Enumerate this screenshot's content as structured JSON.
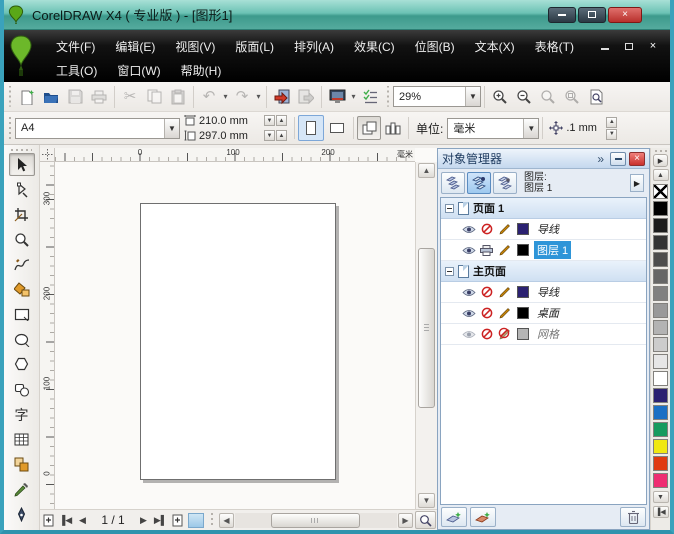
{
  "window": {
    "title": "CorelDRAW X4 ( 专业版 ) - [图形1]"
  },
  "menu": {
    "row1": [
      "文件(F)",
      "编辑(E)",
      "视图(V)",
      "版面(L)",
      "排列(A)",
      "效果(C)",
      "位图(B)",
      "文本(X)",
      "表格(T)"
    ],
    "row2": [
      "工具(O)",
      "窗口(W)",
      "帮助(H)"
    ]
  },
  "toolbar": {
    "zoom_level": "29%"
  },
  "property_bar": {
    "paper_preset": "A4",
    "paper_width": "210.0 mm",
    "paper_height": "297.0 mm",
    "units_label": "单位:",
    "units_value": "毫米",
    "nudge_offset": ".1 mm"
  },
  "rulers": {
    "top_labels": [
      "0",
      "100",
      "200"
    ],
    "top_unit": "毫米",
    "left_labels": [
      "300",
      "200",
      "100",
      "0"
    ]
  },
  "toolbox": {
    "text_tool_glyph": "字",
    "tools": [
      "pick",
      "shape",
      "crop",
      "zoom",
      "freehand",
      "smart-fill",
      "rectangle",
      "ellipse",
      "polygon",
      "basic-shapes",
      "text",
      "table",
      "interactive-blend",
      "eyedropper",
      "outline-pen"
    ]
  },
  "docker": {
    "title": "对象管理器",
    "chevron": "»",
    "layer_caption": "图层:",
    "layer_current": "图层 1",
    "tree": [
      {
        "type": "page",
        "label": "页面 1"
      },
      {
        "type": "layer",
        "label": "导线",
        "visible": true,
        "printable": false,
        "editable": true,
        "color": "#2b2171"
      },
      {
        "type": "layer",
        "label": "图层 1",
        "visible": true,
        "printable": true,
        "editable": true,
        "color": "#000000",
        "selected": true
      },
      {
        "type": "page",
        "label": "主页面"
      },
      {
        "type": "layer",
        "label": "导线",
        "visible": true,
        "printable": false,
        "editable": true,
        "color": "#2b2171"
      },
      {
        "type": "layer",
        "label": "桌面",
        "visible": true,
        "printable": false,
        "editable": true,
        "color": "#000000"
      },
      {
        "type": "layer",
        "label": "网格",
        "visible": false,
        "printable": false,
        "editable": false,
        "color": "#b5b5b5"
      }
    ]
  },
  "navigation": {
    "page_indicator": "1 / 1"
  },
  "palette": {
    "colors": [
      "none",
      "#000000",
      "#1c1c1c",
      "#333333",
      "#4d4d4d",
      "#666666",
      "#808080",
      "#999999",
      "#b3b3b3",
      "#cccccc",
      "#e6e6e6",
      "#ffffff",
      "#2b2171",
      "#1a6fc4",
      "#169b5f",
      "#f0e812",
      "#e03a10",
      "#ee2d72"
    ]
  }
}
